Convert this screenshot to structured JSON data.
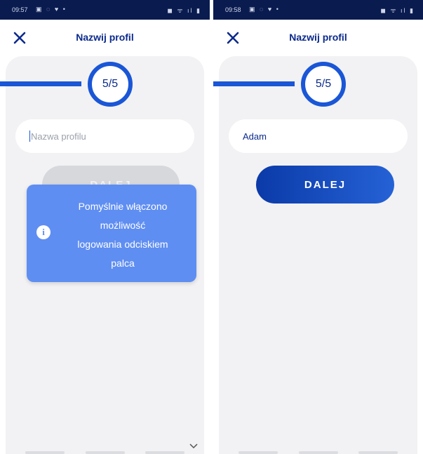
{
  "left": {
    "status": {
      "time": "09:57",
      "left_icons": "▣ ◌ ♥ •",
      "right_icons": "◼ ᯤ ıl ▮"
    },
    "header": {
      "title": "Nazwij profil",
      "close_icon": "close-icon"
    },
    "progress": {
      "step_label": "5/5",
      "fraction": 1.0
    },
    "profile_name": {
      "placeholder": "Nazwa profilu",
      "value": ""
    },
    "next_button": {
      "label": "DALEJ",
      "enabled": false
    },
    "toast": {
      "icon": "info-icon",
      "line1": "Pomyślnie włączono",
      "line2": "możliwość",
      "line3": "logowania odciskiem",
      "line4": "palca"
    },
    "scroll_icon": "chevron-down-icon"
  },
  "right": {
    "status": {
      "time": "09:58",
      "left_icons": "▣ ◌ ♥ •",
      "right_icons": "◼ ᯤ ıl ▮"
    },
    "header": {
      "title": "Nazwij profil",
      "close_icon": "close-icon"
    },
    "progress": {
      "step_label": "5/5",
      "fraction": 1.0
    },
    "profile_name": {
      "placeholder": "Nazwa profilu",
      "value": "Adam"
    },
    "next_button": {
      "label": "DALEJ",
      "enabled": true
    }
  },
  "colors": {
    "primary": "#1a56d6",
    "dark_blue": "#0b2a8c",
    "status_bar": "#0a1b4f",
    "toast": "#5f8ef2"
  }
}
